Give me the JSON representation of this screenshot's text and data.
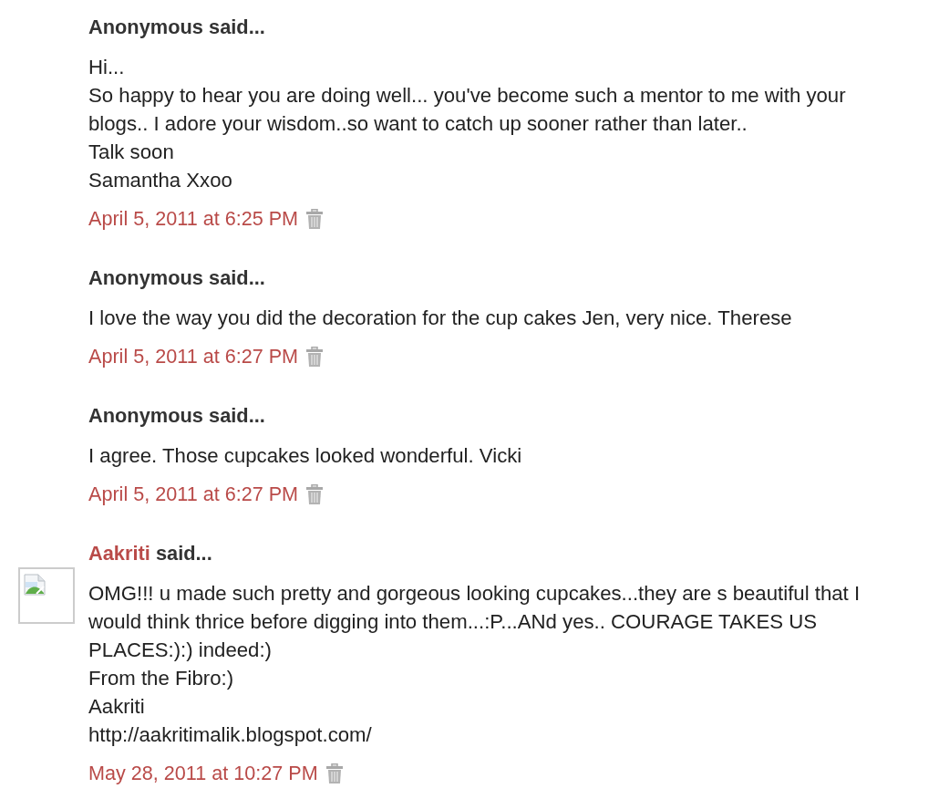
{
  "comments": [
    {
      "author": "Anonymous",
      "linked": false,
      "suffix": "said...",
      "avatar": false,
      "lines": [
        "Hi...",
        "So happy to hear you are doing well... you've become such a mentor to me with your blogs.. I adore your wisdom..so want to catch up sooner rather than later..",
        "Talk soon",
        "Samantha Xxoo"
      ],
      "timestamp": "April 5, 2011 at 6:25 PM"
    },
    {
      "author": "Anonymous",
      "linked": false,
      "suffix": "said...",
      "avatar": false,
      "lines": [
        "I love the way you did the decoration for the cup cakes Jen, very nice. Therese"
      ],
      "timestamp": "April 5, 2011 at 6:27 PM"
    },
    {
      "author": "Anonymous",
      "linked": false,
      "suffix": "said...",
      "avatar": false,
      "lines": [
        "I agree. Those cupcakes looked wonderful. Vicki"
      ],
      "timestamp": "April 5, 2011 at 6:27 PM"
    },
    {
      "author": "Aakriti",
      "linked": true,
      "suffix": "said...",
      "avatar": true,
      "lines": [
        "OMG!!! u made such pretty and gorgeous looking cupcakes...they are s beautiful that I would think thrice before digging into them...:P...ANd yes.. COURAGE TAKES US PLACES:):) indeed:)",
        "From the Fibro:)",
        "Aakriti",
        "http://aakritimalik.blogspot.com/"
      ],
      "timestamp": "May 28, 2011 at 10:27 PM"
    }
  ]
}
